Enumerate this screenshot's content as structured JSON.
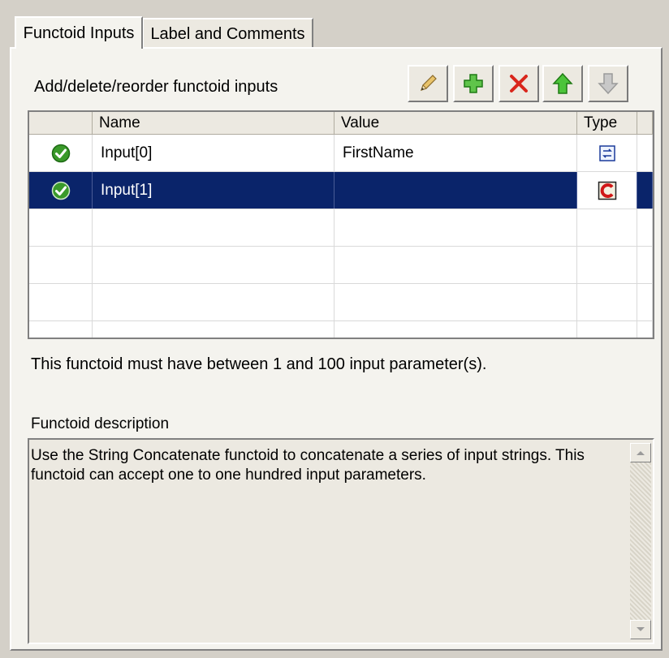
{
  "tabs": [
    {
      "label": "Functoid Inputs",
      "active": true
    },
    {
      "label": "Label and Comments",
      "active": false
    }
  ],
  "toolbar": {
    "caption": "Add/delete/reorder functoid inputs",
    "buttons": [
      "edit-icon",
      "add-icon",
      "delete-icon",
      "move-up-icon",
      "move-down-icon"
    ]
  },
  "grid": {
    "columns": [
      "Name",
      "Value",
      "Type"
    ],
    "rows": [
      {
        "status": "valid",
        "name": "Input[0]",
        "value": "FirstName",
        "type": "link-type-icon"
      },
      {
        "status": "valid",
        "name": "Input[1]",
        "value": "",
        "type": "constant-type-icon",
        "selected": true
      }
    ]
  },
  "info": {
    "count_text": "This functoid must have between 1 and 100 input parameter(s)."
  },
  "description": {
    "label": "Functoid description",
    "text": "Use the String Concatenate functoid to concatenate a series of input strings. This functoid can accept one to one hundred input parameters."
  },
  "colors": {
    "selection": "#0a246a",
    "window": "#d4d0c8",
    "check_green": "#3a9a2a"
  }
}
